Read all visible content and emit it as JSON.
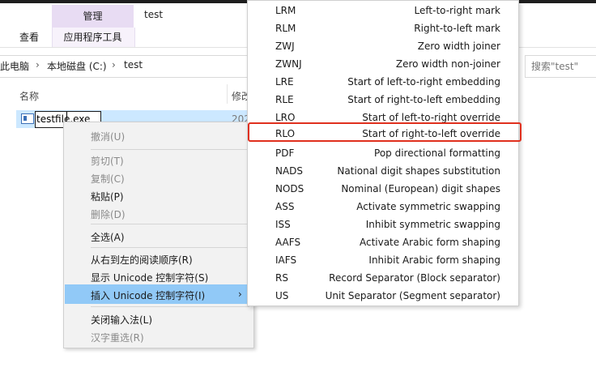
{
  "ribbon": {
    "context_tab": "管理",
    "view_tab": "查看",
    "app_tools_tab": "应用程序工具",
    "window_title": "test"
  },
  "address": {
    "crumbs": [
      "此电脑",
      "本地磁盘 (C:)",
      "test"
    ],
    "search_placeholder": "搜索\"test\""
  },
  "columns": {
    "name": "名称",
    "date": "修改"
  },
  "file": {
    "name": "testfile.exe",
    "date": "202"
  },
  "context_menu": {
    "items": [
      {
        "label": "撤消(U)",
        "disabled": true
      },
      {
        "label": "剪切(T)",
        "disabled": true
      },
      {
        "label": "复制(C)",
        "disabled": true
      },
      {
        "label": "粘贴(P)",
        "disabled": false
      },
      {
        "label": "删除(D)",
        "disabled": true
      },
      {
        "label": "全选(A)",
        "disabled": false
      },
      {
        "label": "从右到左的阅读顺序(R)",
        "disabled": false
      },
      {
        "label": "显示 Unicode 控制字符(S)",
        "disabled": false
      },
      {
        "label": "插入 Unicode 控制字符(I)",
        "disabled": false,
        "highlighted": true
      },
      {
        "label": "关闭输入法(L)",
        "disabled": false
      },
      {
        "label": "汉字重选(R)",
        "disabled": true
      }
    ],
    "submenu_arrow": "›"
  },
  "unicode_submenu": {
    "items": [
      {
        "code": "LRM",
        "desc": "Left-to-right mark"
      },
      {
        "code": "RLM",
        "desc": "Right-to-left mark"
      },
      {
        "code": "ZWJ",
        "desc": "Zero width joiner"
      },
      {
        "code": "ZWNJ",
        "desc": "Zero width non-joiner"
      },
      {
        "code": "LRE",
        "desc": "Start of left-to-right embedding"
      },
      {
        "code": "RLE",
        "desc": "Start of right-to-left embedding"
      },
      {
        "code": "LRO",
        "desc": "Start of left-to-right override"
      },
      {
        "code": "RLO",
        "desc": "Start of right-to-left override",
        "highlighted": true
      },
      {
        "code": "PDF",
        "desc": "Pop directional formatting"
      },
      {
        "code": "NADS",
        "desc": "National digit shapes substitution"
      },
      {
        "code": "NODS",
        "desc": "Nominal (European) digit shapes"
      },
      {
        "code": "ASS",
        "desc": "Activate symmetric swapping"
      },
      {
        "code": "ISS",
        "desc": "Inhibit symmetric swapping"
      },
      {
        "code": "AAFS",
        "desc": "Activate Arabic form shaping"
      },
      {
        "code": "IAFS",
        "desc": "Inhibit Arabic form shaping"
      },
      {
        "code": "RS",
        "desc": "Record Separator (Block separator)"
      },
      {
        "code": "US",
        "desc": "Unit Separator (Segment separator)"
      }
    ]
  },
  "colors": {
    "selection": "#cce8ff",
    "menu_highlight": "#91c9f7",
    "annotation_box": "#e0301e",
    "context_tab_bg": "#e8dcf3"
  }
}
